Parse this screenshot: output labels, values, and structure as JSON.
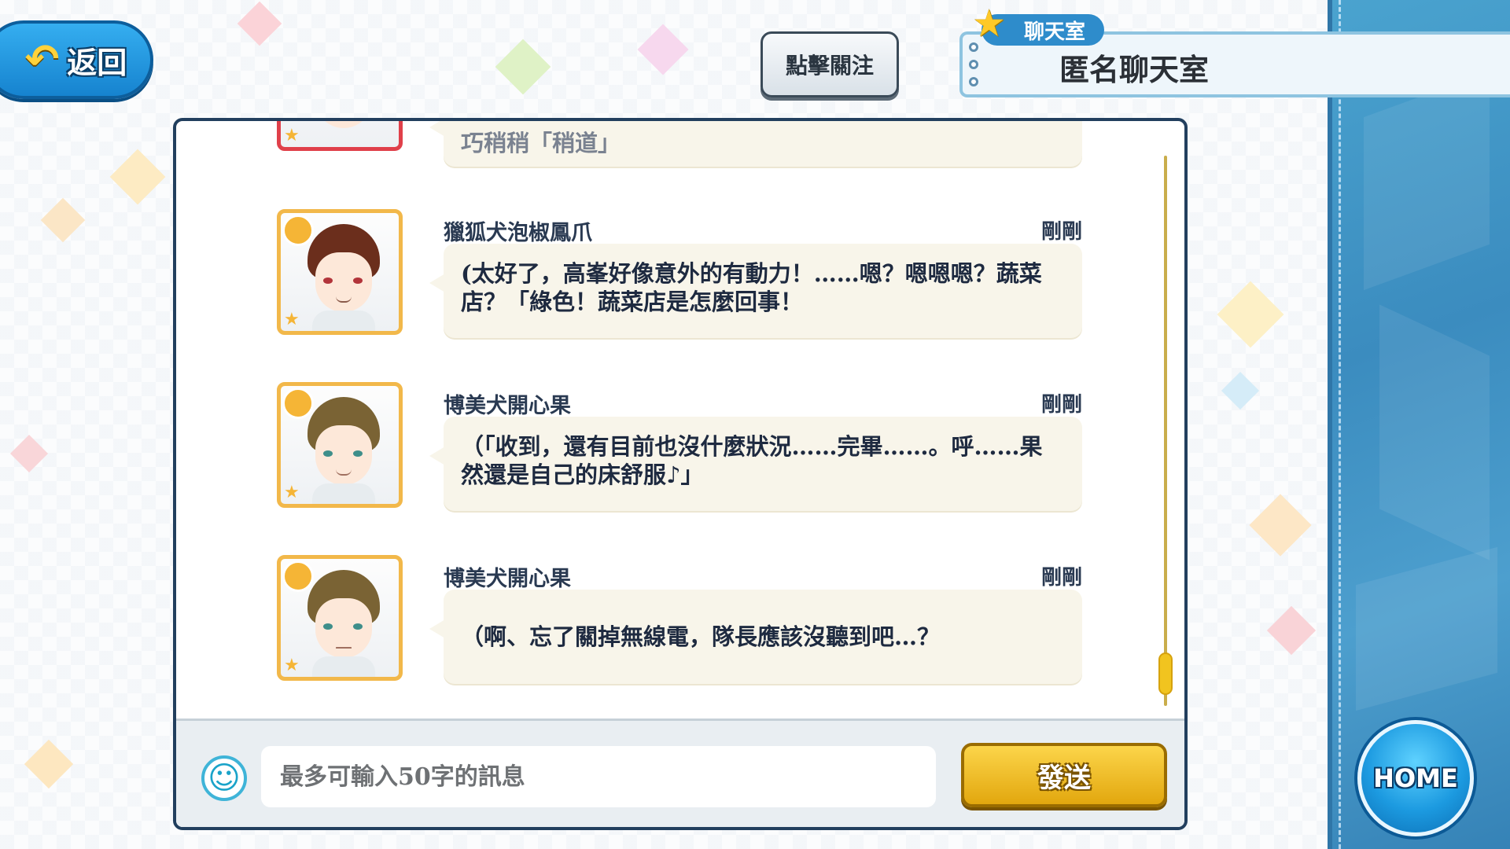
{
  "header": {
    "back_label": "返回",
    "follow_label": "點擊關注",
    "room_tag": "聊天室",
    "room_name": "匿名聊天室"
  },
  "chat": {
    "partial_top_text": "巧稍稍「稍道」",
    "messages": [
      {
        "sender": "獵狐犬泡椒鳳爪",
        "time": "剛剛",
        "text": "(太好了，高峯好像意外的有動力！……嗯？嗯嗯嗯？蔬菜店？「綠色！蔬菜店是怎麼回事！",
        "hair_color": "#6b2e1c",
        "eye_color": "#b2343a"
      },
      {
        "sender": "博美犬開心果",
        "time": "剛剛",
        "text": "（「收到，還有目前也沒什麼狀況……完畢……。呼……果然還是自己的床舒服♪」",
        "hair_color": "#7a6334",
        "eye_color": "#3e8e8a"
      },
      {
        "sender": "博美犬開心果",
        "time": "剛剛",
        "text": "（啊、忘了關掉無線電，隊長應該沒聽到吧…？",
        "hair_color": "#7a6334",
        "eye_color": "#3e8e8a"
      }
    ]
  },
  "input": {
    "placeholder": "最多可輸入50字的訊息",
    "value": "",
    "send_label": "發送",
    "emoji_icon": "smiley-icon"
  },
  "home_label": "HOME",
  "colors": {
    "accent_blue": "#2e8ccb",
    "send_gold": "#f1c41f",
    "panel_border": "#223f5e",
    "avatar_border": "#f2b84a"
  }
}
